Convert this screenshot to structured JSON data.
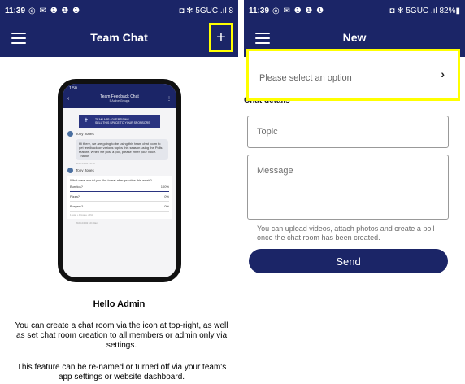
{
  "left": {
    "status": {
      "time": "11:39",
      "icons": "◎ ✉ ❶ ❶ ❶",
      "right": "◘ ✻ 5GUC .ıl 8"
    },
    "appbar": {
      "title": "Team Chat",
      "plus": "+"
    },
    "phone": {
      "time": "1:50",
      "header_title": "Team Feedback Chat",
      "header_sub": "5 Active Groups",
      "ad_line1": "TEAM APP ADVERTISING",
      "ad_line2": "SELL THIS SPACE TO YOUR SPONSORS",
      "msg1_author": "Tony Jones",
      "msg1_text": "Hi there, we are going to be using this team chat room to get feedback on various topics this season using the Polls feature. When we post a poll, please enter your voice. Thanks",
      "msg1_time": "2020-04-02 10:40",
      "msg2_author": "Tony Jones",
      "poll_question": "What meal would you like to eat after practice this week?",
      "poll_options": [
        {
          "label": "Burritos?",
          "pct": "100%"
        },
        {
          "label": "Pizza?",
          "pct": "0%"
        },
        {
          "label": "Burgers?",
          "pct": "0%"
        }
      ],
      "poll_footer": "1 vote • Anyone • Poll",
      "msg2_time": "2020-04-02 10:40am"
    },
    "hello": "Hello Admin",
    "desc1": "You can create a chat room via the icon at top-right, as well as set chat room creation to all members or admin only via settings.",
    "desc2": "This feature can be re-named or turned off via your team's app settings or website dashboard."
  },
  "right": {
    "status": {
      "time": "11:39",
      "icons": "◎ ✉ ❶ ❶ ❶",
      "right": "◘ ✻ 5GUC .ıl 82%▮"
    },
    "appbar": {
      "title": "New"
    },
    "select_placeholder": "Please select an option",
    "section_label": "Chat details",
    "topic_placeholder": "Topic",
    "message_placeholder": "Message",
    "hint": "You can upload videos, attach photos and create a poll once the chat room has been created.",
    "send_label": "Send"
  },
  "colors": {
    "navy": "#1b2567",
    "highlight": "#ffff00"
  }
}
